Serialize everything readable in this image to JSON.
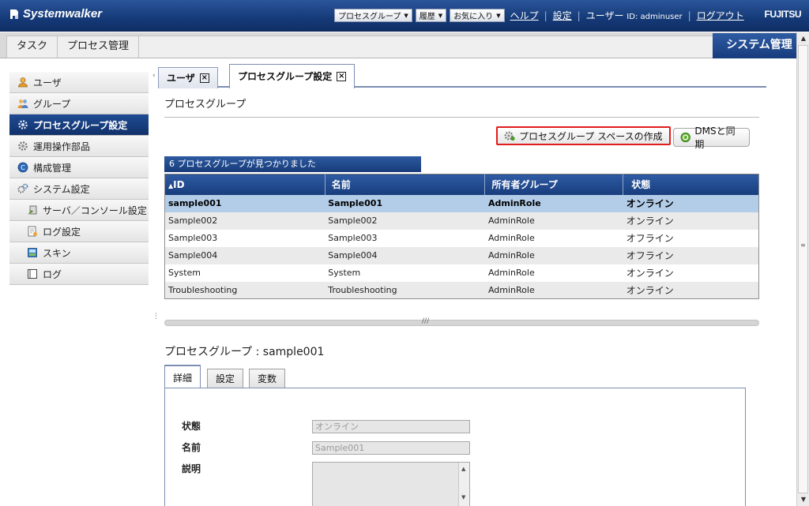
{
  "topbar": {
    "product": "Systemwalker",
    "menus": [
      "プロセスグループ",
      "履歴",
      "お気に入り"
    ],
    "help": "ヘルプ",
    "settings": "設定",
    "user_prefix": "ユーザー",
    "user_id": "ID: adminuser",
    "logout": "ログアウト",
    "vendor": "FUJITSU"
  },
  "navbar": {
    "tabs": [
      "タスク",
      "プロセス管理"
    ],
    "system_admin": "システム管理"
  },
  "sidebar": {
    "items": [
      {
        "label": "ユーザ",
        "icon": "user-icon"
      },
      {
        "label": "グループ",
        "icon": "group-icon"
      },
      {
        "label": "プロセスグループ設定",
        "icon": "gear-icon",
        "active": true
      },
      {
        "label": "運用操作部品",
        "icon": "component-icon"
      },
      {
        "label": "構成管理",
        "icon": "config-icon"
      },
      {
        "label": "システム設定",
        "icon": "system-settings-icon"
      },
      {
        "label": "サーバ／コンソール設定",
        "icon": "server-settings-icon",
        "sub": true
      },
      {
        "label": "ログ設定",
        "icon": "log-settings-icon",
        "sub": true
      },
      {
        "label": "スキン",
        "icon": "skin-icon",
        "sub": true
      },
      {
        "label": "ログ",
        "icon": "log-icon",
        "sub": true
      }
    ]
  },
  "main": {
    "tabs": [
      "ユーザ",
      "プロセスグループ設定"
    ],
    "section_title": "プロセスグループ",
    "create_button": "プロセスグループ スペースの作成",
    "sync_button": "DMSと同期",
    "found_text": "6 プロセスグループが見つかりました",
    "table": {
      "columns": [
        "ID",
        "名前",
        "所有者グループ",
        "状態"
      ],
      "rows": [
        [
          "sample001",
          "Sample001",
          "AdminRole",
          "オンライン"
        ],
        [
          "Sample002",
          "Sample002",
          "AdminRole",
          "オンライン"
        ],
        [
          "Sample003",
          "Sample003",
          "AdminRole",
          "オフライン"
        ],
        [
          "Sample004",
          "Sample004",
          "AdminRole",
          "オフライン"
        ],
        [
          "System",
          "System",
          "AdminRole",
          "オンライン"
        ],
        [
          "Troubleshooting",
          "Troubleshooting",
          "AdminRole",
          "オンライン"
        ]
      ],
      "selected_row": 0
    },
    "detail": {
      "title": "プロセスグループ : sample001",
      "tabs": [
        "詳細",
        "設定",
        "変数"
      ],
      "fields": {
        "status_label": "状態",
        "status_value": "オンライン",
        "name_label": "名前",
        "name_value": "Sample001",
        "desc_label": "説明"
      }
    }
  },
  "colors": {
    "header_blue": "#173c7c",
    "selected_row": "#b3cde9",
    "highlight_red": "#e01c1c"
  }
}
